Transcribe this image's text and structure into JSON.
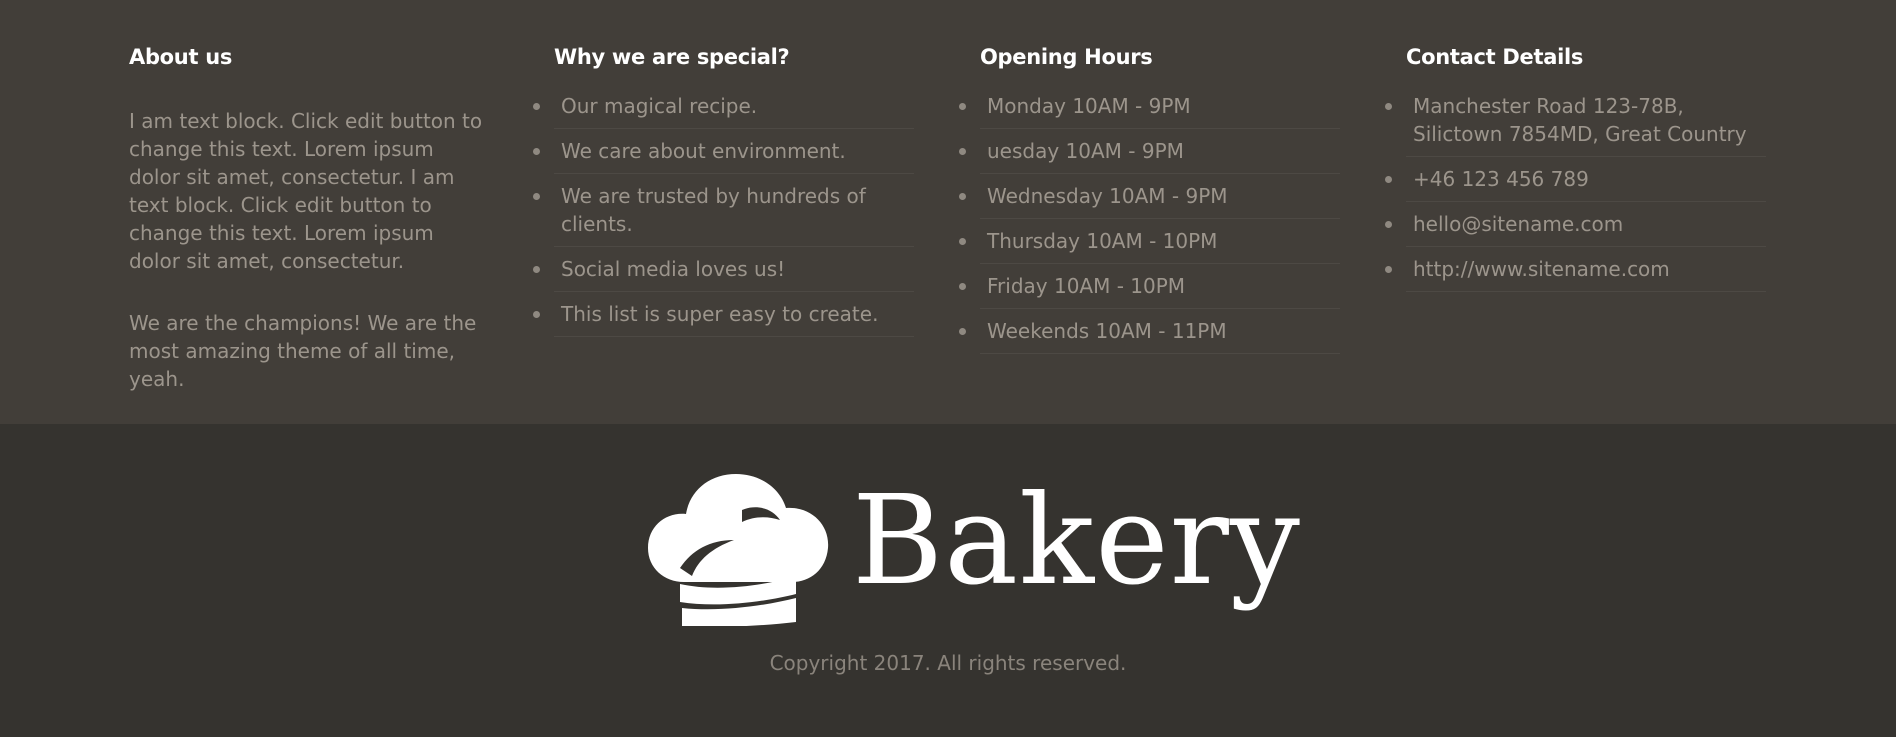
{
  "colors": {
    "footer_top_bg": "#423e39",
    "footer_bottom_bg": "#35332f",
    "heading": "#ffffff",
    "text": "#9c958c"
  },
  "about": {
    "title": "About us",
    "paragraph1": "I am text block. Click edit button to change this text. Lorem ipsum dolor sit amet, consectetur. I am text block. Click edit button to change this text. Lorem ipsum dolor sit amet, consectetur.",
    "paragraph2": "We are the champions! We are the most amazing theme of all time, yeah."
  },
  "special": {
    "title": "Why we are special?",
    "items": [
      "Our magical recipe.",
      "We care about environment.",
      "We are trusted by hundreds of clients.",
      "Social media loves us!",
      "This list is super easy to create."
    ]
  },
  "hours": {
    "title": "Opening Hours",
    "items": [
      "Monday 10AM - 9PM",
      "uesday 10AM - 9PM",
      "Wednesday 10AM - 9PM",
      "Thursday 10AM - 10PM",
      "Friday 10AM - 10PM",
      "Weekends 10AM - 11PM"
    ]
  },
  "contact": {
    "title": "Contact Details",
    "items": [
      "Manchester Road 123-78B, Silictown 7854MD, Great Country",
      "+46 123 456 789",
      "hello@sitename.com",
      "http://www.sitename.com"
    ]
  },
  "logo": {
    "icon": "chef-hat-icon",
    "text": "Bakery"
  },
  "copyright": "Copyright 2017. All rights reserved."
}
